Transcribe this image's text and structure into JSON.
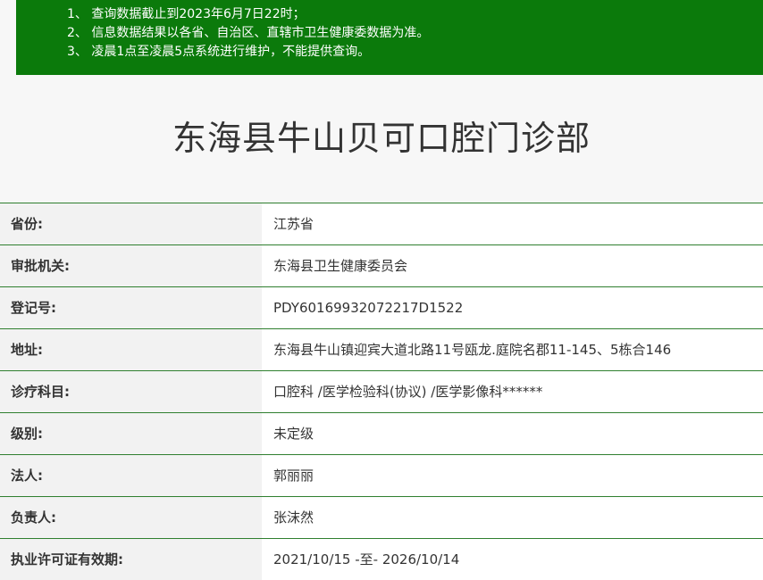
{
  "notice": {
    "lines": [
      "1、 查询数据截止到2023年6月7日22时；",
      "2、 信息数据结果以各省、自治区、直辖市卫生健康委数据为准。",
      "3、 凌晨1点至凌晨5点系统进行维护，不能提供查询。"
    ],
    "background": "#0b7a0b"
  },
  "title": "东海县牛山贝可口腔门诊部",
  "rows": [
    {
      "label": "省份:",
      "value": "江苏省"
    },
    {
      "label": "审批机关:",
      "value": "东海县卫生健康委员会"
    },
    {
      "label": "登记号:",
      "value": "PDY60169932072217D1522"
    },
    {
      "label": "地址:",
      "value": "东海县牛山镇迎宾大道北路11号瓯龙.庭院名郡11-145、5栋合146"
    },
    {
      "label": "诊疗科目:",
      "value": "口腔科 /医学检验科(协议) /医学影像科******"
    },
    {
      "label": "级别:",
      "value": "未定级"
    },
    {
      "label": "法人:",
      "value": "郭丽丽"
    },
    {
      "label": "负责人:",
      "value": "张沫然"
    },
    {
      "label": "执业许可证有效期:",
      "value": "2021/10/15 -至- 2026/10/14"
    }
  ],
  "colors": {
    "border": "#2f7f2f",
    "label_bg": "#f2f2f2",
    "value_bg": "#ffffff"
  }
}
